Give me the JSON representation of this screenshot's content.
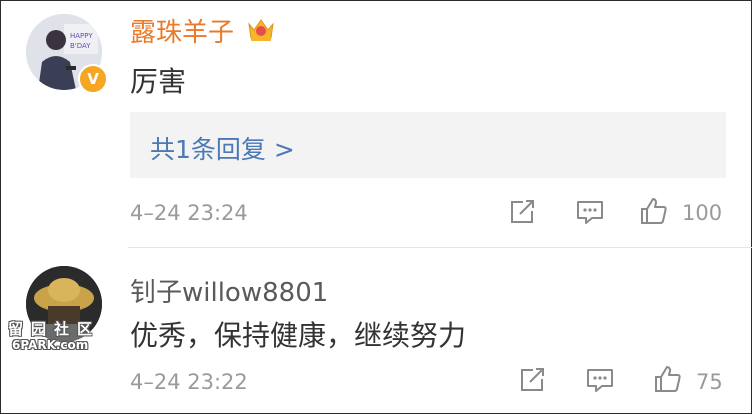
{
  "comments": [
    {
      "username": "露珠羊子",
      "text": "厉害",
      "reply_link": "共1条回复 >",
      "time": "4–24 23:24",
      "likes": "100",
      "verified_badge": "V",
      "crown_icon": "crown-icon"
    },
    {
      "username": "钊子willow8801",
      "text": "优秀，保持健康，继续努力",
      "time": "4–24 23:22",
      "likes": "75"
    }
  ],
  "watermark": {
    "line1": "留园社区",
    "line2": "6PARK.com"
  },
  "colors": {
    "vip_name": "#ea7a2a",
    "link": "#4a79b6",
    "meta": "#9a9a9a",
    "badge": "#f5a623"
  }
}
